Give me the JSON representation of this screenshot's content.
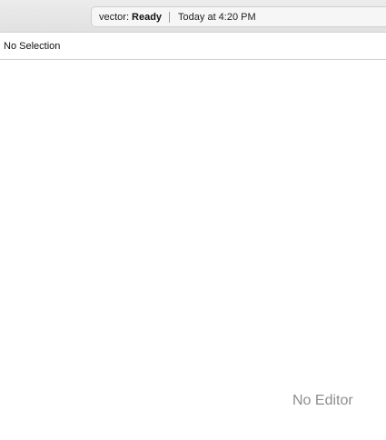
{
  "activity": {
    "scheme": "vector:",
    "state": "Ready",
    "time": "Today at 4:20 PM"
  },
  "jumpbar": {
    "label": "No Selection"
  },
  "editor": {
    "placeholder": "No Editor"
  }
}
